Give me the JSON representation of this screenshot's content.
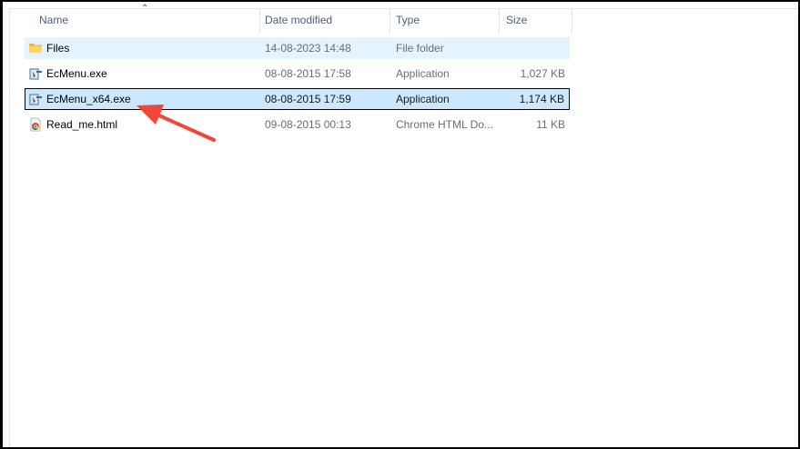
{
  "columns": {
    "name": "Name",
    "date": "Date modified",
    "type": "Type",
    "size": "Size"
  },
  "files": [
    {
      "name": "Files",
      "date": "14-08-2023 14:48",
      "type": "File folder",
      "size": "",
      "icon": "folder-icon"
    },
    {
      "name": "EcMenu.exe",
      "date": "08-08-2015 17:58",
      "type": "Application",
      "size": "1,027 KB",
      "icon": "application-icon"
    },
    {
      "name": "EcMenu_x64.exe",
      "date": "08-08-2015 17:59",
      "type": "Application",
      "size": "1,174 KB",
      "icon": "application-icon"
    },
    {
      "name": "Read_me.html",
      "date": "09-08-2015 00:13",
      "type": "Chrome HTML Do...",
      "size": "11 KB",
      "icon": "chrome-icon"
    }
  ],
  "colors": {
    "annotation_arrow": "#f0473a",
    "selection": "#cce8ff",
    "hover": "#e5f3ff"
  }
}
